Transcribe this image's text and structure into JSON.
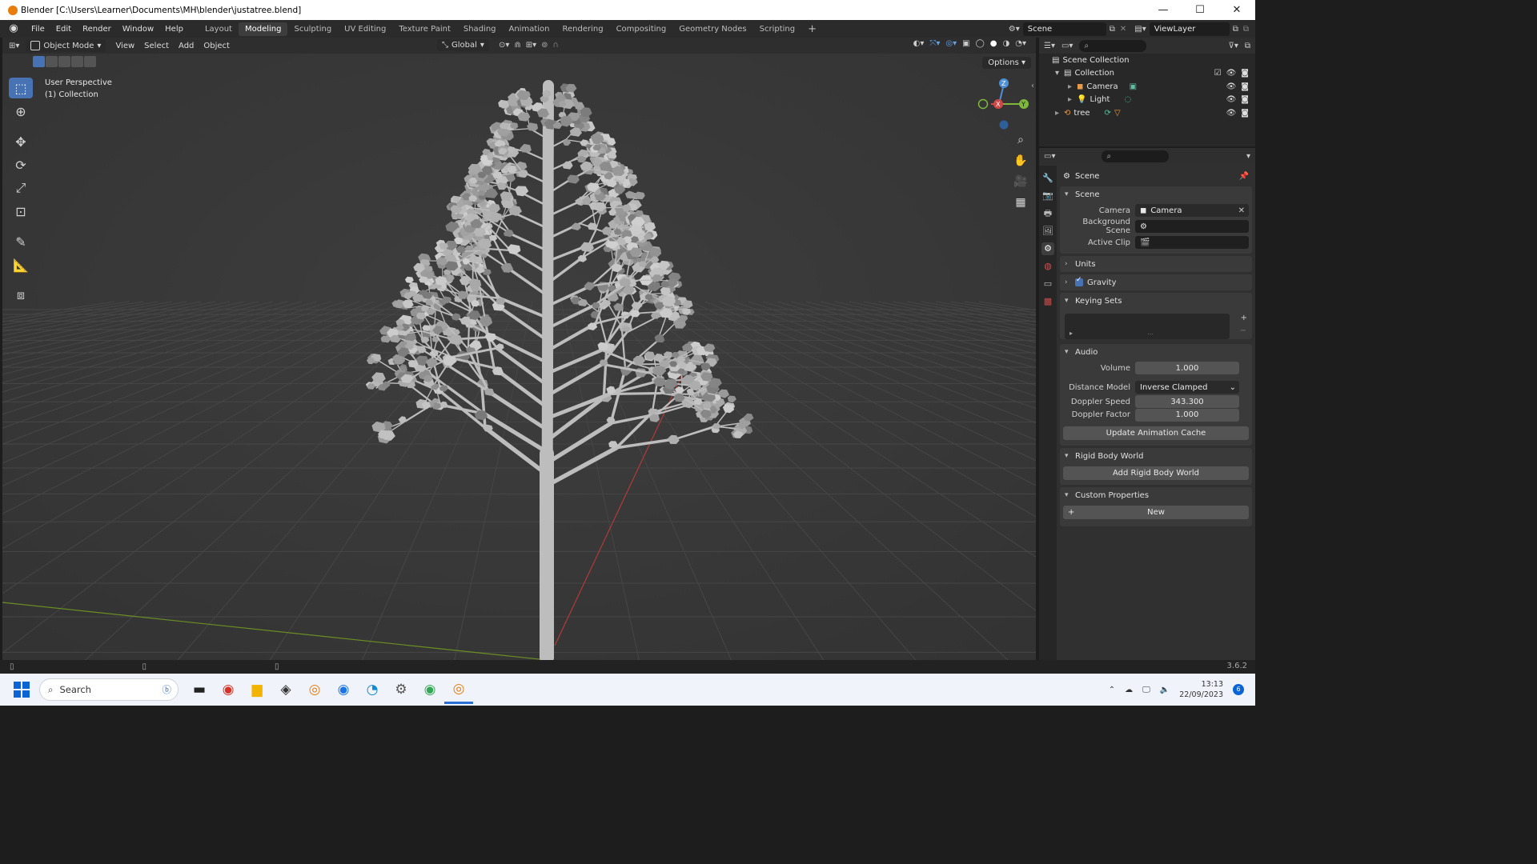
{
  "window": {
    "title": "Blender [C:\\Users\\Learner\\Documents\\MH\\blender\\justatree.blend]",
    "minimize": "—",
    "maximize": "☐",
    "close": "✕"
  },
  "menubar": {
    "menus": [
      "File",
      "Edit",
      "Render",
      "Window",
      "Help"
    ],
    "workspaces": [
      "Layout",
      "Modeling",
      "Sculpting",
      "UV Editing",
      "Texture Paint",
      "Shading",
      "Animation",
      "Rendering",
      "Compositing",
      "Geometry Nodes",
      "Scripting"
    ],
    "active_workspace": "Modeling",
    "add_tab": "+",
    "scene_name": "Scene",
    "view_layer": "ViewLayer"
  },
  "viewport": {
    "mode": "Object Mode",
    "menus": [
      "View",
      "Select",
      "Add",
      "Object"
    ],
    "transform_orientation": "Global",
    "options_label": "Options",
    "overlay_line1": "User Perspective",
    "overlay_line2": "(1) Collection",
    "gizmo": {
      "x": "X",
      "y": "Y",
      "z": "Z"
    }
  },
  "outliner": {
    "root": "Scene Collection",
    "items": [
      {
        "name": "Collection"
      },
      {
        "name": "Camera"
      },
      {
        "name": "Light"
      },
      {
        "name": "tree"
      }
    ]
  },
  "properties": {
    "title": "Scene",
    "scene_section": "Scene",
    "camera_label": "Camera",
    "camera_value": "Camera",
    "background_scene_label": "Background Scene",
    "active_clip_label": "Active Clip",
    "units": "Units",
    "gravity": "Gravity",
    "keying_sets": "Keying Sets",
    "audio": "Audio",
    "volume_label": "Volume",
    "volume_value": "1.000",
    "distance_model_label": "Distance Model",
    "distance_model_value": "Inverse Clamped",
    "doppler_speed_label": "Doppler Speed",
    "doppler_speed_value": "343.300",
    "doppler_factor_label": "Doppler Factor",
    "doppler_factor_value": "1.000",
    "update_anim_cache": "Update Animation Cache",
    "rigid_body_world": "Rigid Body World",
    "add_rigid_body_world": "Add Rigid Body World",
    "custom_properties": "Custom Properties",
    "new_label": "New"
  },
  "statusbar": {
    "version": "3.6.2"
  },
  "taskbar": {
    "search_placeholder": "Search",
    "time": "13:13",
    "date": "22/09/2023",
    "notifications": "6"
  }
}
